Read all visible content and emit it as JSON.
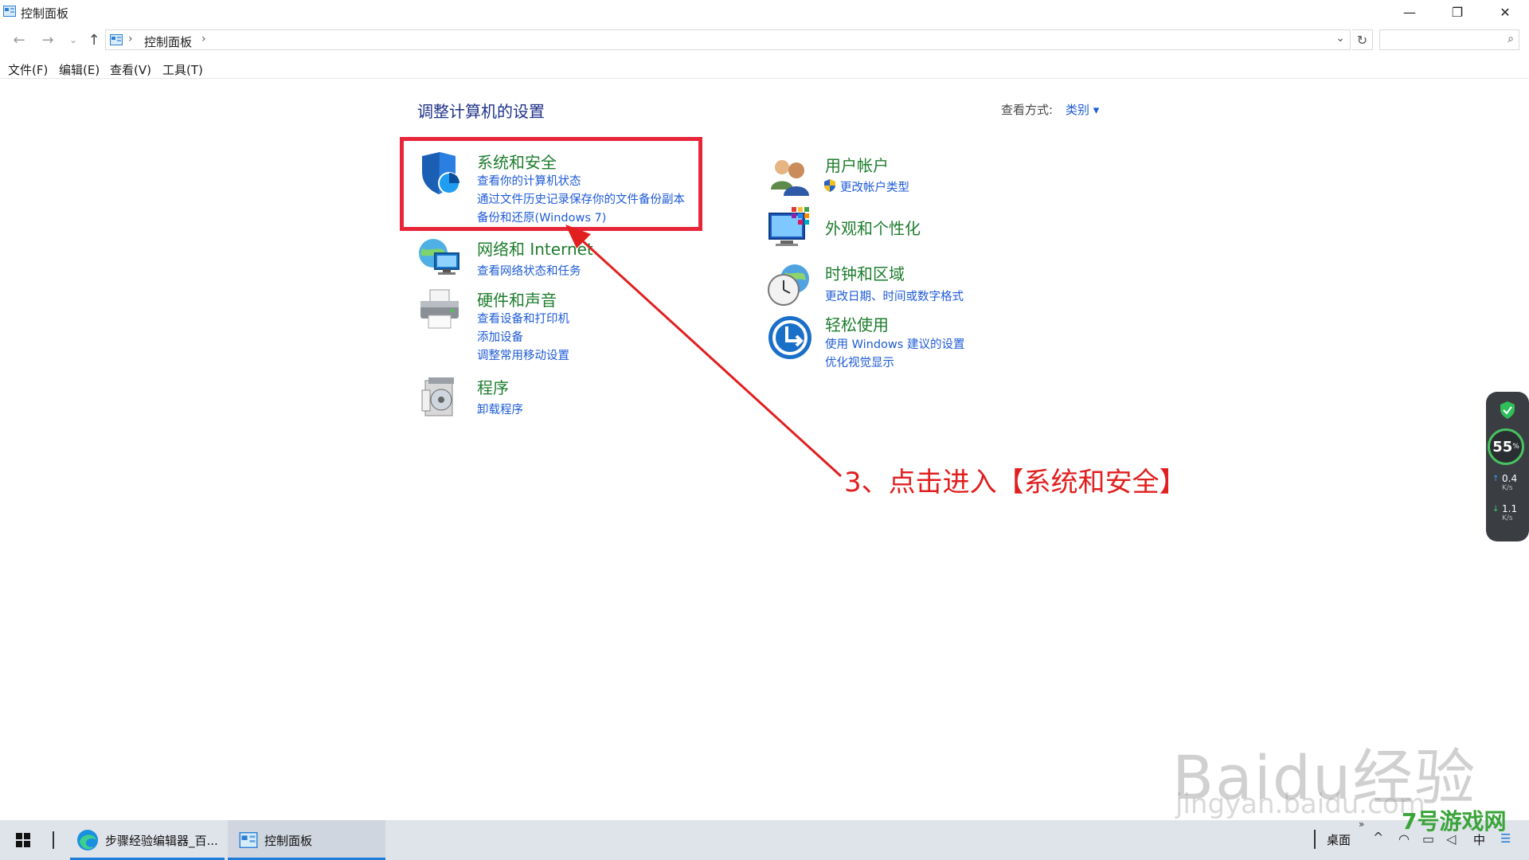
{
  "window": {
    "title": "控制面板",
    "minimize": "—",
    "maximize": "❐",
    "close": "✕"
  },
  "address": {
    "crumb": "控制面板",
    "search_placeholder": ""
  },
  "menubar": {
    "items": [
      "文件(F)",
      "编辑(E)",
      "查看(V)",
      "工具(T)"
    ]
  },
  "content": {
    "heading": "调整计算机的设置",
    "view_by_label": "查看方式:",
    "view_by_value": "类别 ▾",
    "categories": [
      {
        "title": "系统和安全",
        "links": [
          "查看你的计算机状态",
          "通过文件历史记录保存你的文件备份副本",
          "备份和还原(Windows 7)"
        ],
        "icon": "shield-icon"
      },
      {
        "title": "网络和 Internet",
        "links": [
          "查看网络状态和任务"
        ],
        "icon": "network-icon"
      },
      {
        "title": "硬件和声音",
        "links": [
          "查看设备和打印机",
          "添加设备",
          "调整常用移动设置"
        ],
        "icon": "printer-icon"
      },
      {
        "title": "程序",
        "links": [
          "卸载程序"
        ],
        "icon": "programs-icon"
      },
      {
        "title": "用户帐户",
        "links": [
          "更改帐户类型"
        ],
        "icon": "users-icon"
      },
      {
        "title": "外观和个性化",
        "links": [],
        "icon": "appearance-icon"
      },
      {
        "title": "时钟和区域",
        "links": [
          "更改日期、时间或数字格式"
        ],
        "icon": "clock-icon"
      },
      {
        "title": "轻松使用",
        "links": [
          "使用 Windows 建议的设置",
          "优化视觉显示"
        ],
        "icon": "ease-of-access-icon"
      }
    ]
  },
  "annotation": {
    "text": "3、点击进入【系统和安全】",
    "color": "#e11f1f"
  },
  "widget": {
    "percent": "55",
    "percent_unit": "%",
    "up_value": "0.4",
    "up_unit": "K/s",
    "down_value": "1.1",
    "down_unit": "K/s"
  },
  "taskbar": {
    "items": [
      {
        "label": "步骤经验编辑器_百...",
        "icon": "edge-icon"
      },
      {
        "label": "控制面板",
        "icon": "control-panel-icon"
      }
    ],
    "desktop_label": "桌面",
    "ime_label": "中"
  },
  "watermarks": {
    "baidu": "Baidu经验",
    "jingyan": "jingyan.baidu.com",
    "site": "7号游戏网"
  }
}
